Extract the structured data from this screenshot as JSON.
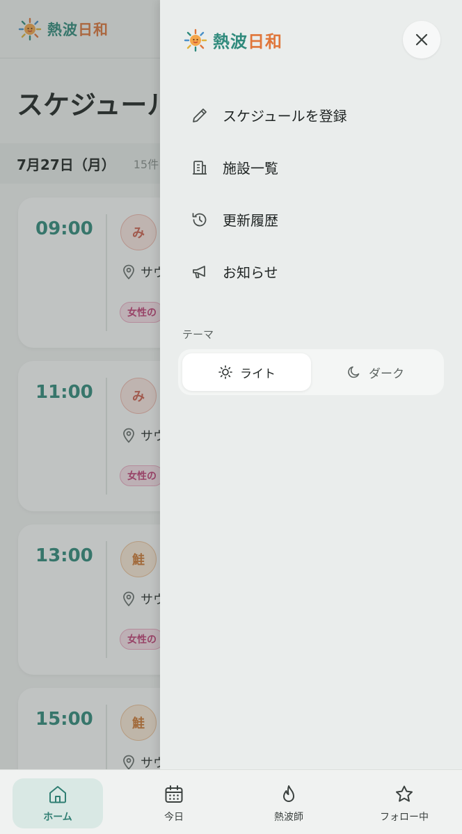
{
  "brand": {
    "name_part1": "熱波",
    "name_part2": "日和"
  },
  "background": {
    "page_title": "スケジュール",
    "date": "7月27日（月）",
    "count": "15件",
    "cards": [
      {
        "time": "09:00",
        "avatar": "み",
        "place": "サウ",
        "tag": "女性の"
      },
      {
        "time": "11:00",
        "avatar": "み",
        "place": "サウ",
        "tag": "女性の"
      },
      {
        "time": "13:00",
        "avatar": "鮭",
        "place": "サウ",
        "tag": "女性の"
      },
      {
        "time": "15:00",
        "avatar": "鮭",
        "place": "サウ"
      }
    ]
  },
  "drawer": {
    "menu": [
      {
        "label": "スケジュールを登録",
        "icon": "pencil-icon"
      },
      {
        "label": "施設一覧",
        "icon": "building-icon"
      },
      {
        "label": "更新履歴",
        "icon": "history-icon"
      },
      {
        "label": "お知らせ",
        "icon": "megaphone-icon"
      }
    ],
    "theme_label": "テーマ",
    "theme_light": "ライト",
    "theme_dark": "ダーク"
  },
  "bottom_nav": [
    {
      "label": "ホーム",
      "icon": "home-icon"
    },
    {
      "label": "今日",
      "icon": "calendar-icon"
    },
    {
      "label": "熱波師",
      "icon": "flame-icon"
    },
    {
      "label": "フォロー中",
      "icon": "star-icon"
    }
  ],
  "colors": {
    "accent": "#2f8a7c",
    "brand_orange": "#e0763a",
    "tag_pink": "#c23d76"
  }
}
